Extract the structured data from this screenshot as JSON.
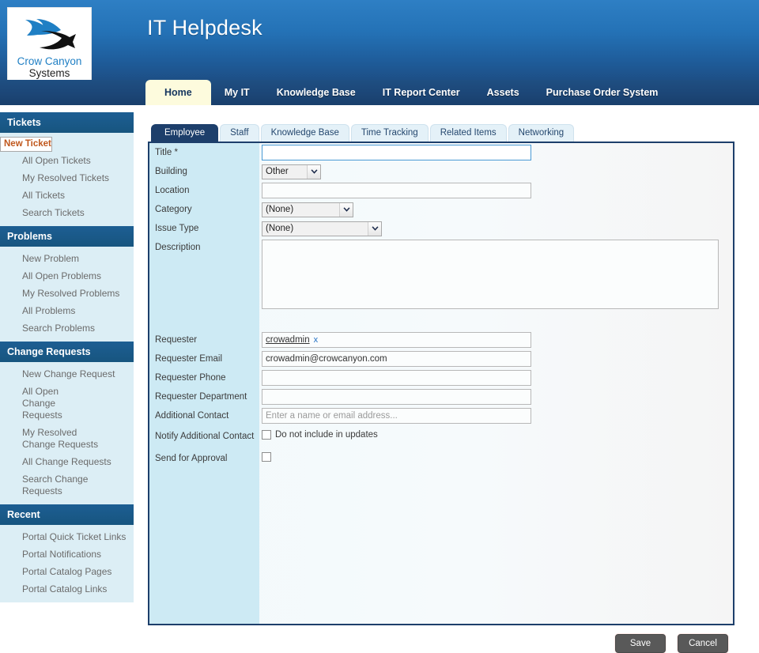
{
  "header": {
    "site_title": "IT Helpdesk",
    "logo": {
      "line1": "Crow Canyon",
      "line2": "Systems",
      "icon": "crow-canyon-swoosh-logo"
    },
    "nav": [
      {
        "label": "Home",
        "active": true
      },
      {
        "label": "My IT",
        "active": false
      },
      {
        "label": "Knowledge Base",
        "active": false
      },
      {
        "label": "IT Report Center",
        "active": false
      },
      {
        "label": "Assets",
        "active": false
      },
      {
        "label": "Purchase Order System",
        "active": false
      }
    ]
  },
  "sidebar": {
    "groups": [
      {
        "title": "Tickets",
        "items": [
          {
            "label": "New Ticket",
            "selected": true
          },
          {
            "label": "All Open Tickets",
            "selected": false
          },
          {
            "label": "My Resolved Tickets",
            "selected": false
          },
          {
            "label": "All Tickets",
            "selected": false
          },
          {
            "label": "Search Tickets",
            "selected": false
          }
        ]
      },
      {
        "title": "Problems",
        "items": [
          {
            "label": "New Problem",
            "selected": false
          },
          {
            "label": "All Open Problems",
            "selected": false
          },
          {
            "label": "My Resolved Problems",
            "selected": false
          },
          {
            "label": "All Problems",
            "selected": false
          },
          {
            "label": "Search Problems",
            "selected": false
          }
        ]
      },
      {
        "title": "Change Requests",
        "items": [
          {
            "label": "New Change Request",
            "selected": false
          },
          {
            "label": "All Open Change Requests",
            "selected": false
          },
          {
            "label": "My Resolved Change Requests",
            "selected": false
          },
          {
            "label": "All Change Requests",
            "selected": false
          },
          {
            "label": "Search Change Requests",
            "selected": false
          }
        ]
      },
      {
        "title": "Recent",
        "items": [
          {
            "label": "Portal Quick Ticket Links",
            "selected": false
          },
          {
            "label": "Portal Notifications",
            "selected": false
          },
          {
            "label": "Portal Catalog Pages",
            "selected": false
          },
          {
            "label": "Portal Catalog Links",
            "selected": false
          }
        ]
      }
    ]
  },
  "form_tabs": [
    {
      "label": "Employee",
      "active": true
    },
    {
      "label": "Staff",
      "active": false
    },
    {
      "label": "Knowledge Base",
      "active": false
    },
    {
      "label": "Time Tracking",
      "active": false
    },
    {
      "label": "Related Items",
      "active": false
    },
    {
      "label": "Networking",
      "active": false
    }
  ],
  "form": {
    "title": {
      "label": "Title *",
      "value": "",
      "placeholder": "",
      "focused": true
    },
    "building": {
      "label": "Building",
      "value": "Other"
    },
    "location": {
      "label": "Location",
      "value": "",
      "placeholder": ""
    },
    "category": {
      "label": "Category",
      "value": "(None)"
    },
    "issue_type": {
      "label": "Issue Type",
      "value": "(None)"
    },
    "description": {
      "label": "Description",
      "value": ""
    },
    "requester": {
      "label": "Requester",
      "value": "crowadmin",
      "remove_label": "x"
    },
    "requester_email": {
      "label": "Requester Email",
      "value": "crowadmin@crowcanyon.com"
    },
    "requester_phone": {
      "label": "Requester Phone",
      "value": "",
      "placeholder": ""
    },
    "requester_department": {
      "label": "Requester Department",
      "value": "",
      "placeholder": ""
    },
    "additional_contact": {
      "label": "Additional Contact",
      "value": "",
      "placeholder": "Enter a name or email address..."
    },
    "notify_additional_contact": {
      "label": "Notify Additional Contact",
      "checkbox_label": "Do not include in updates",
      "checked": false
    },
    "send_for_approval": {
      "label": "Send for Approval",
      "checked": false
    }
  },
  "actions": {
    "save_label": "Save",
    "cancel_label": "Cancel"
  },
  "colors": {
    "header_blue": "#2472b6",
    "nav_navy": "#1c4677",
    "active_tab_cream": "#fdfbdd",
    "sidebar_group_bg": "#dceef5",
    "sidebar_header_blue": "#1a5785",
    "selected_item_orange": "#c0571c",
    "form_border_navy": "#1d3f6b",
    "label_col_blue": "#cdeaf4",
    "button_gray": "#595959"
  }
}
